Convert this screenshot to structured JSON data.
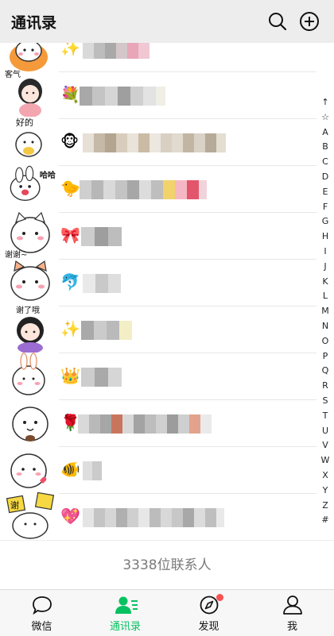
{
  "header": {
    "title": "通讯录",
    "search_icon": "search-icon",
    "add_icon": "plus-circle-icon"
  },
  "contacts": [
    {
      "avatar": "rabbit-sticker",
      "emoji": "✨"
    },
    {
      "avatar": "girl-sticker-keqi",
      "sticker_text": "客气",
      "emoji": "💐"
    },
    {
      "avatar": "sticker-haode",
      "sticker_text": "好的",
      "emoji": "🐵"
    },
    {
      "avatar": "rabbit-sticker-haha",
      "sticker_text": "哈哈哈",
      "emoji": "🐤"
    },
    {
      "avatar": "cat-sticker-xiexie",
      "sticker_text": "谢谢~",
      "emoji": "🎀"
    },
    {
      "avatar": "cat-sticker",
      "emoji": "🐬"
    },
    {
      "avatar": "girl-sticker-xiele",
      "sticker_text": "谢了哦",
      "emoji": "✨"
    },
    {
      "avatar": "rabbit-sticker",
      "emoji": "👑"
    },
    {
      "avatar": "bun-sticker",
      "emoji": "🌹"
    },
    {
      "avatar": "cat-sticker-heart",
      "emoji": "🐠"
    },
    {
      "avatar": "sticker-xie-signs",
      "sticker_text": "谢",
      "emoji": "💖"
    }
  ],
  "index": [
    "↑",
    "☆",
    "A",
    "B",
    "C",
    "D",
    "E",
    "F",
    "G",
    "H",
    "I",
    "J",
    "K",
    "L",
    "M",
    "N",
    "O",
    "P",
    "Q",
    "R",
    "S",
    "T",
    "U",
    "V",
    "W",
    "X",
    "Y",
    "Z",
    "#"
  ],
  "footer": {
    "count_text": "3338位联系人"
  },
  "tabs": [
    {
      "label": "微信",
      "icon": "chat-bubble-icon"
    },
    {
      "label": "通讯录",
      "icon": "contacts-icon",
      "active": true
    },
    {
      "label": "发现",
      "icon": "compass-icon",
      "badge": true
    },
    {
      "label": "我",
      "icon": "person-icon"
    }
  ],
  "colors": {
    "accent": "#07c160",
    "header_bg": "#ededed",
    "badge": "#fa5151"
  }
}
